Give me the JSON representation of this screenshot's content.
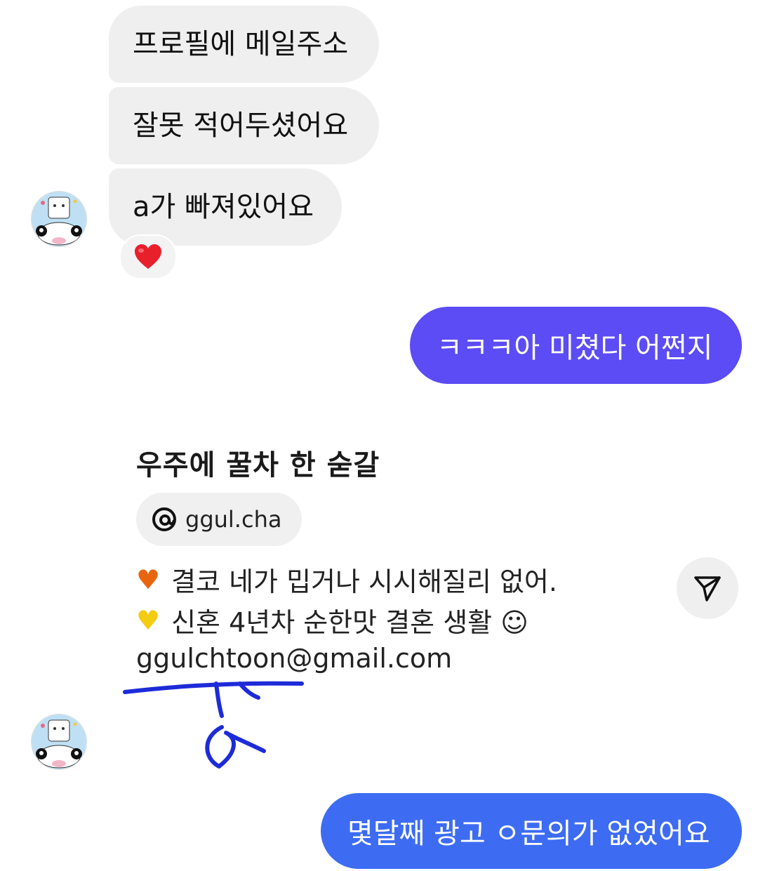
{
  "conversation": {
    "messages_in": [
      {
        "text": "프로필에 메일주소"
      },
      {
        "text": "잘못 적어두셨어요"
      },
      {
        "text": "a가 빠져있어요"
      }
    ],
    "reaction_emoji": "❤️",
    "message_out_1": "ㅋㅋㅋ아 미쳤다 어쩐지",
    "message_out_2": "몇달째 광고 ㅇ문의가 없었어요",
    "colors": {
      "outgoing_1": "#5b4cf5",
      "outgoing_2": "#3d6cf3",
      "incoming": "#efefef",
      "annotation": "#1d2bd8"
    }
  },
  "shared_profile": {
    "name": "우주에 꿀차 한 숟갈",
    "handle": "ggul.cha",
    "handle_icon": "threads-icon",
    "bio_lines": [
      {
        "emoji": "🧡",
        "text": "결코 네가 밉거나 시시해질리 없어."
      },
      {
        "emoji": "💛",
        "text": "신혼 4년차 순한맛 결혼 생활 ☺"
      }
    ],
    "email": "ggulchtoon@gmail.com"
  },
  "icons": {
    "send": "send-icon",
    "avatar": "avatar"
  }
}
